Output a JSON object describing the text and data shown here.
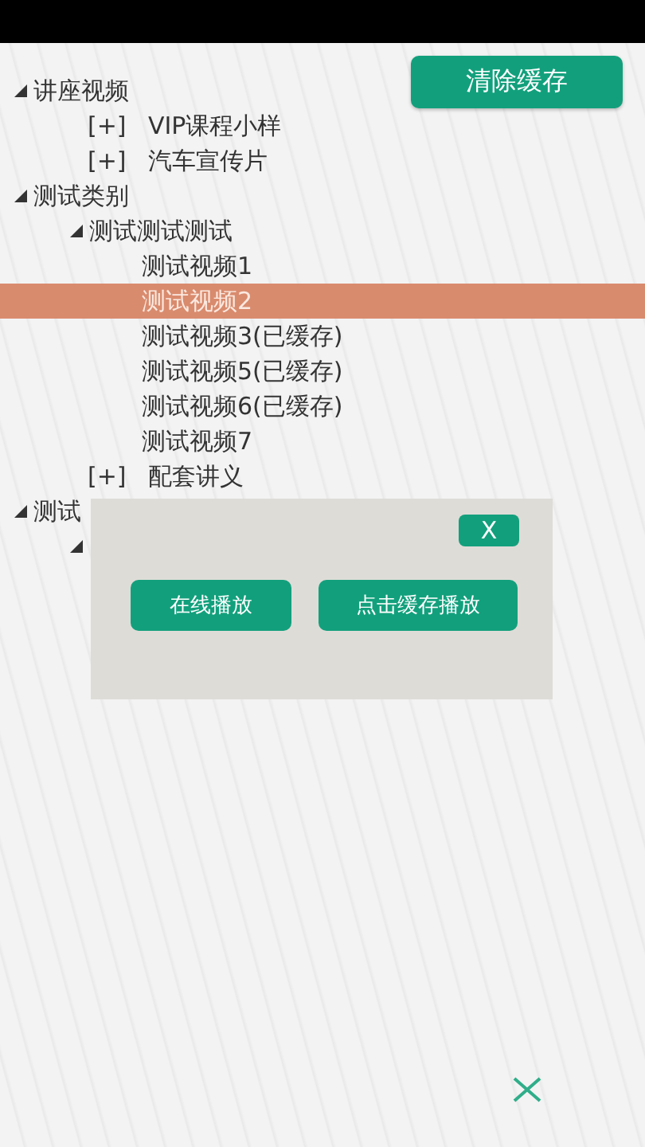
{
  "clear_cache_button": "清除缓存",
  "tree": [
    {
      "label": "讲座视频",
      "expanded": true,
      "children": [
        {
          "label": "VIP课程小样",
          "expanded": false,
          "toggle": "[+]"
        },
        {
          "label": "汽车宣传片",
          "expanded": false,
          "toggle": "[+]"
        }
      ]
    },
    {
      "label": "测试类别",
      "expanded": true,
      "children": [
        {
          "label": "测试测试测试",
          "expanded": true,
          "children": [
            {
              "label": "测试视频1",
              "selected": false
            },
            {
              "label": "测试视频2",
              "selected": true
            },
            {
              "label": "测试视频3(已缓存)",
              "selected": false
            },
            {
              "label": "测试视频5(已缓存)",
              "selected": false
            },
            {
              "label": "测试视频6(已缓存)",
              "selected": false
            },
            {
              "label": "测试视频7",
              "selected": false
            }
          ]
        },
        {
          "label": "配套讲义",
          "expanded": false,
          "toggle": "[+]"
        }
      ]
    },
    {
      "label": "测试",
      "expanded": true,
      "children": [
        {
          "expanded": true
        }
      ]
    }
  ],
  "dialog": {
    "close": "X",
    "buttons": [
      "在线播放",
      "点击缓存播放"
    ]
  }
}
